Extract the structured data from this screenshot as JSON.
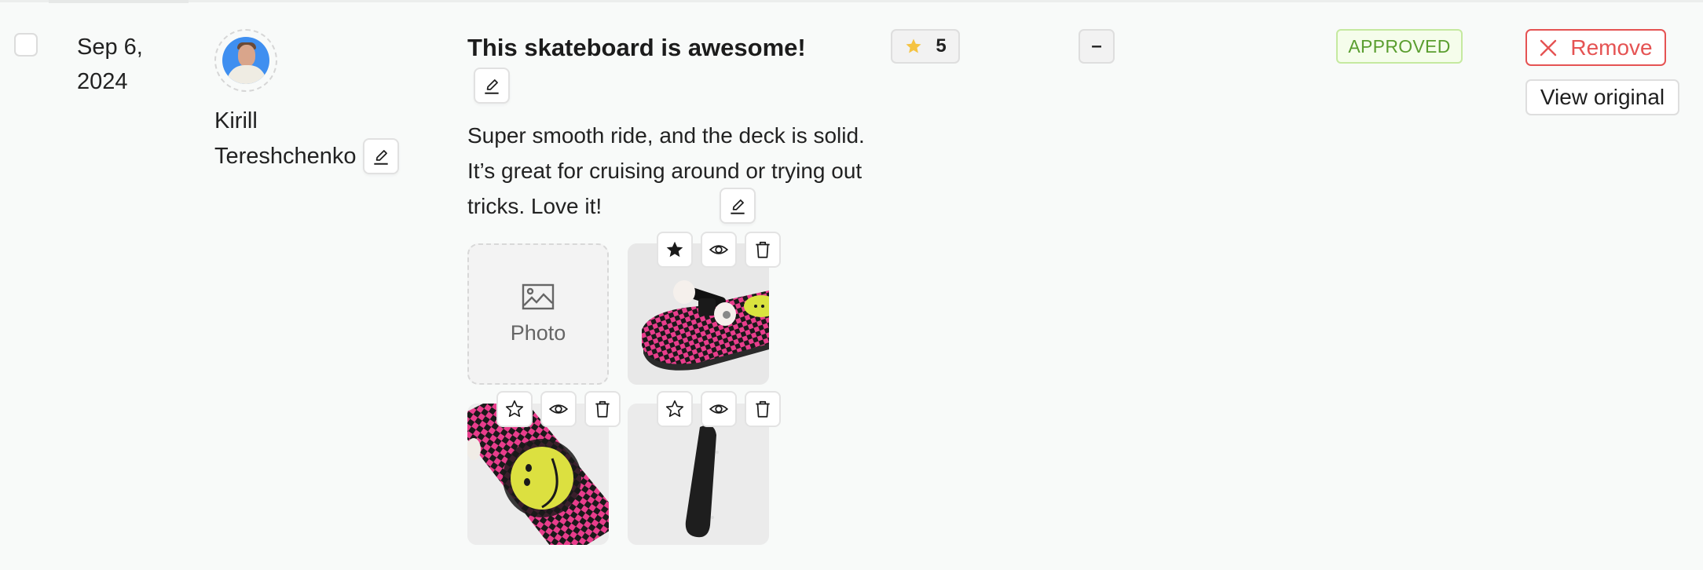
{
  "review": {
    "selected": false,
    "date": "Sep 6, 2024",
    "author": {
      "first_name": "Kirill",
      "last_name": "Tereshchenko",
      "avatar_icon": "user-avatar"
    },
    "title": "This skateboard is awesome!",
    "body": "Super smooth ride, and the deck is solid. It’s great for cruising around or trying out tricks. Love it!",
    "rating": {
      "value": "5",
      "icon": "star-icon",
      "star_color": "#f5c342"
    },
    "secondary_badge": "–",
    "status": {
      "label": "APPROVED",
      "color": "#5a9e2f",
      "background": "#f5fdeb",
      "border": "#c5e9a0"
    }
  },
  "media": {
    "add_photo_label": "Photo",
    "add_photo_icon": "image-icon",
    "photos": [
      {
        "alt": "Skateboard underside with checkered pink deck and trucks",
        "featured": true
      },
      {
        "alt": "Skateboard deck with yellow smiley face on pink checkered swirl",
        "featured": false
      },
      {
        "alt": "Black skateboard standing upright",
        "featured": false
      }
    ],
    "actions": [
      "feature-star",
      "preview-eye",
      "delete-trash"
    ]
  },
  "actions": {
    "remove_label": "Remove",
    "remove_color": "#e55353",
    "view_original_label": "View original"
  }
}
